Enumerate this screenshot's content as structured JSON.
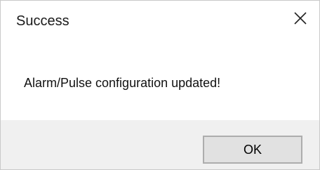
{
  "dialog": {
    "title": "Success",
    "close_icon": "close-icon",
    "message": "Alarm/Pulse configuration updated!",
    "ok_label": "OK"
  },
  "colors": {
    "footer_background": "#f0f0f0",
    "button_background": "#e1e1e1",
    "button_border": "#adadad"
  }
}
